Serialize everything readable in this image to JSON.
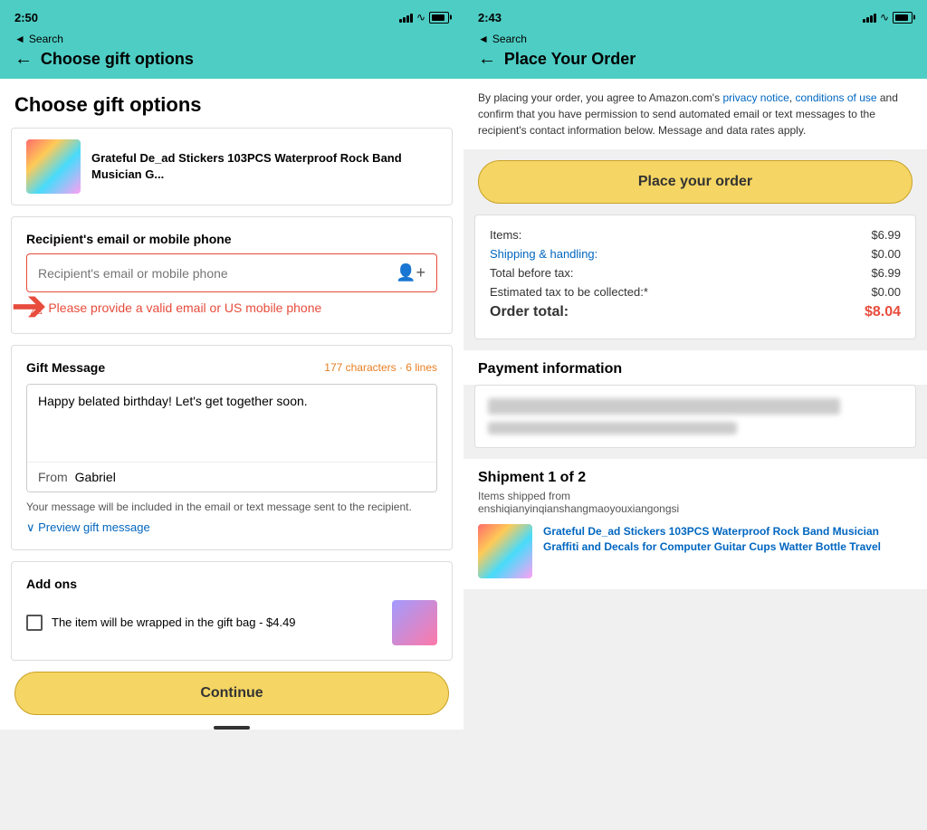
{
  "left": {
    "statusBar": {
      "time": "2:50",
      "timeIcon": "◂",
      "searchLabel": "Search"
    },
    "header": {
      "title": "Choose gift options",
      "backLabel": "←"
    },
    "pageTitle": "Choose gift options",
    "product": {
      "name": "Grateful De_ad Stickers 103PCS Waterproof Rock Band Musician G..."
    },
    "recipientField": {
      "label": "Recipient's email or mobile phone",
      "placeholder": "Recipient's email or mobile phone",
      "errorText": "Please provide a valid email or US mobile phone"
    },
    "giftMessage": {
      "title": "Gift Message",
      "charCount": "177 characters · 6 lines",
      "messageText": "Happy belated birthday! Let's get together soon.",
      "fromLabel": "From",
      "fromValue": "Gabriel",
      "hint": "Your message will be included in the email or text message sent to the recipient.",
      "previewLabel": "∨ Preview gift message"
    },
    "addons": {
      "title": "Add ons",
      "itemText": "The item will be wrapped in the gift bag - $4.49"
    },
    "continueButton": "Continue"
  },
  "right": {
    "statusBar": {
      "time": "2:43",
      "timeIcon": "◂",
      "searchLabel": "Search"
    },
    "header": {
      "title": "Place Your Order",
      "backLabel": "←"
    },
    "orderInfoText": "By placing your order, you agree to Amazon.com's ",
    "privacyLink": "privacy notice",
    "conditionsLink": "conditions of use",
    "orderInfoRest": " and confirm that you have permission to send automated email or text messages to the recipient's contact information below. Message and data rates apply.",
    "placeOrderButton": "Place your order",
    "summary": {
      "items": {
        "label": "Items:",
        "value": "$6.99"
      },
      "shipping": {
        "label": "Shipping & handling:",
        "value": "$0.00"
      },
      "beforeTax": {
        "label": "Total before tax:",
        "value": "$6.99"
      },
      "estimatedTax": {
        "label": "Estimated tax to be collected:*",
        "value": "$0.00"
      },
      "total": {
        "label": "Order total:",
        "value": "$8.04"
      }
    },
    "paymentTitle": "Payment information",
    "shipment": {
      "title": "Shipment 1 of 2",
      "fromLabel": "Items shipped from",
      "fromValue": "enshiqianyinqianshangmaoyouxiangongsi",
      "productName": "Grateful De_ad Stickers 103PCS Waterproof Rock Band Musician",
      "productNameLink": "Graffiti and Decals for Computer Guitar Cups Watter Bottle Travel"
    }
  }
}
